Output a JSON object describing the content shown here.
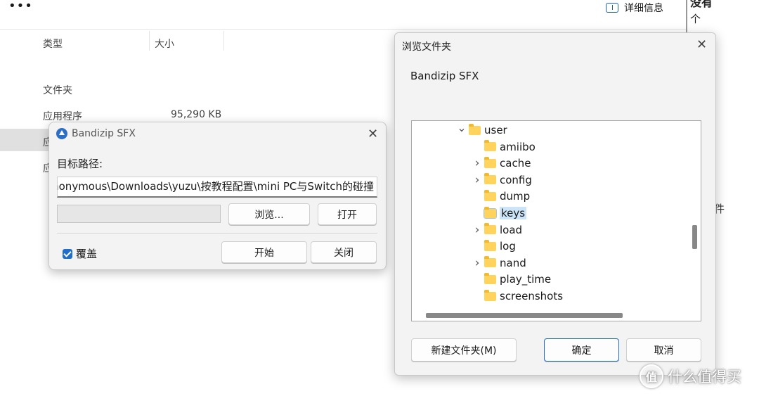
{
  "explorer": {
    "more_icon": "more-horizontal-icon",
    "details_label": "详细信息",
    "right_panel_top": "没有",
    "right_panel_second": "个",
    "right_panel_third": "件",
    "columns": {
      "type": "类型",
      "size": "大小"
    },
    "rows": [
      {
        "type": "文件夹",
        "size": ""
      },
      {
        "type": "应用程序",
        "size": "95,290 KB"
      },
      {
        "type": "应",
        "size": ""
      },
      {
        "type": "应",
        "size": ""
      }
    ]
  },
  "sfx_dialog": {
    "title": "Bandizip SFX",
    "target_label": "目标路径:",
    "path_value": "nonymous\\Downloads\\yuzu\\按教程配置\\mini PC与Switch的碰撞",
    "progress": 0,
    "browse_button": "浏览...",
    "open_button": "打开",
    "overwrite_label": "覆盖",
    "overwrite_checked": true,
    "start_button": "开始",
    "close_button": "关闭",
    "close_icon": "close-icon"
  },
  "browse_dialog": {
    "title": "浏览文件夹",
    "subtitle": "Bandizip SFX",
    "tree": [
      {
        "label": "user",
        "expander": "expanded",
        "selected": false
      },
      {
        "label": "amiibo",
        "expander": "none",
        "selected": false
      },
      {
        "label": "cache",
        "expander": "collapsed",
        "selected": false
      },
      {
        "label": "config",
        "expander": "collapsed",
        "selected": false
      },
      {
        "label": "dump",
        "expander": "none",
        "selected": false
      },
      {
        "label": "keys",
        "expander": "none",
        "selected": true
      },
      {
        "label": "load",
        "expander": "collapsed",
        "selected": false
      },
      {
        "label": "log",
        "expander": "none",
        "selected": false
      },
      {
        "label": "nand",
        "expander": "collapsed",
        "selected": false
      },
      {
        "label": "play_time",
        "expander": "none",
        "selected": false
      },
      {
        "label": "screenshots",
        "expander": "none",
        "selected": false
      }
    ],
    "new_folder_button": "新建文件夹(M)",
    "ok_button": "确定",
    "cancel_button": "取消",
    "close_icon": "close-icon"
  },
  "watermark": {
    "text": "什么值得买",
    "glyph": "值"
  },
  "colors": {
    "accent": "#1f6fc9",
    "folder": "#ffd35c",
    "selection": "#cce4f7"
  }
}
